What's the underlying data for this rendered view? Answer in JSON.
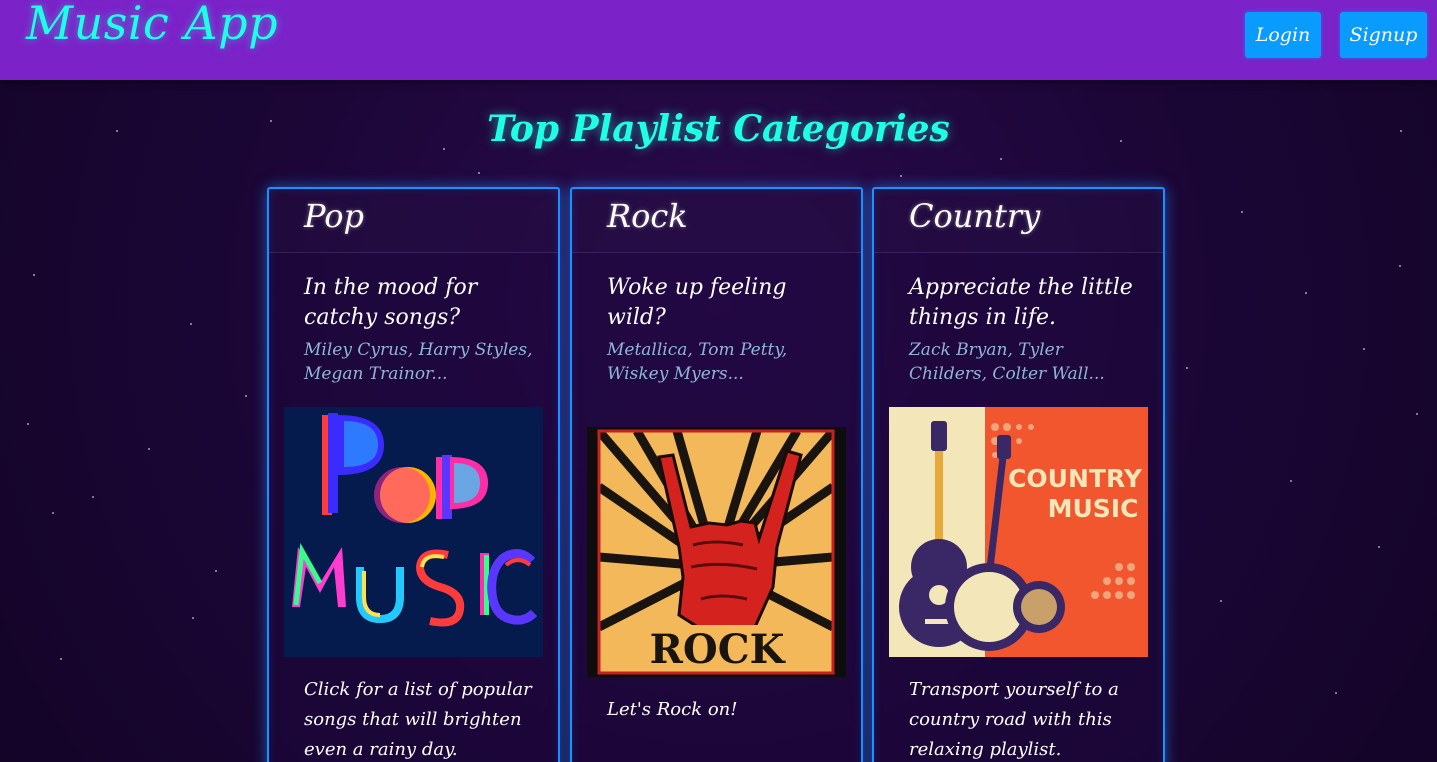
{
  "app": {
    "brand": "Music App",
    "login_label": "Login",
    "signup_label": "Signup"
  },
  "section": {
    "title": "Top Playlist Categories"
  },
  "cards": [
    {
      "title": "Pop",
      "subtitle": "In the mood for catchy songs?",
      "artists": "Miley Cyrus, Harry Styles, Megan Trainor...",
      "image": {
        "icon": "pop-music-art",
        "text_line1": "Pop",
        "text_line2": "MUSIC"
      },
      "description": "Click for a list of popular songs that will brighten even a rainy day."
    },
    {
      "title": "Rock",
      "subtitle": "Woke up feeling wild?",
      "artists": "Metallica, Tom Petty, Wiskey Myers...",
      "image": {
        "icon": "rock-hand-art",
        "text": "ROCK"
      },
      "description": "Let's Rock on!"
    },
    {
      "title": "Country",
      "subtitle": "Appreciate the little things in life.",
      "artists": "Zack Bryan, Tyler Childers, Colter Wall...",
      "image": {
        "icon": "country-guitar-art",
        "text_line1": "COUNTRY",
        "text_line2": "MUSIC"
      },
      "description": "Transport yourself to a country road with this relaxing playlist."
    }
  ],
  "colors": {
    "nav": "#7b22c9",
    "accent": "#1fffe6",
    "button": "#0a9bff",
    "card_border": "#1e8fff",
    "background": "#1a0633"
  }
}
